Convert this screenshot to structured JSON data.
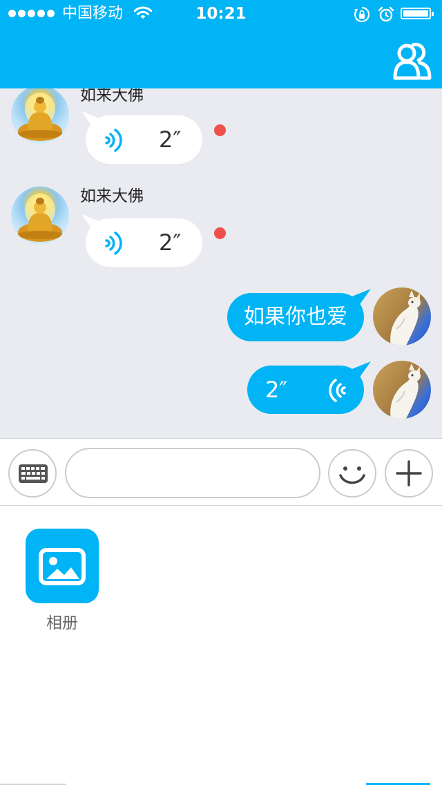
{
  "status_bar": {
    "carrier": "中国移动",
    "time": "10:21",
    "signal_bars": 5
  },
  "header": {
    "contacts_icon": "contacts-icon"
  },
  "messages": [
    {
      "direction": "incoming",
      "sender": "如来大佛",
      "type": "voice",
      "duration": "2″",
      "unread": true
    },
    {
      "direction": "incoming",
      "sender": "如来大佛",
      "type": "voice",
      "duration": "2″",
      "unread": true
    },
    {
      "direction": "outgoing",
      "type": "text",
      "text": "如果你也爱"
    },
    {
      "direction": "outgoing",
      "type": "voice",
      "duration": "2″"
    }
  ],
  "input_bar": {
    "keyboard_icon": "keyboard-icon",
    "input_value": "",
    "emoji_icon": "smile-icon",
    "plus_icon": "plus-icon"
  },
  "more_panel": {
    "items": [
      {
        "label": "相册",
        "icon": "picture-icon"
      }
    ]
  },
  "colors": {
    "accent": "#00b4f5",
    "chat_background": "#e9ebf0",
    "unread_dot": "#f0504a"
  }
}
